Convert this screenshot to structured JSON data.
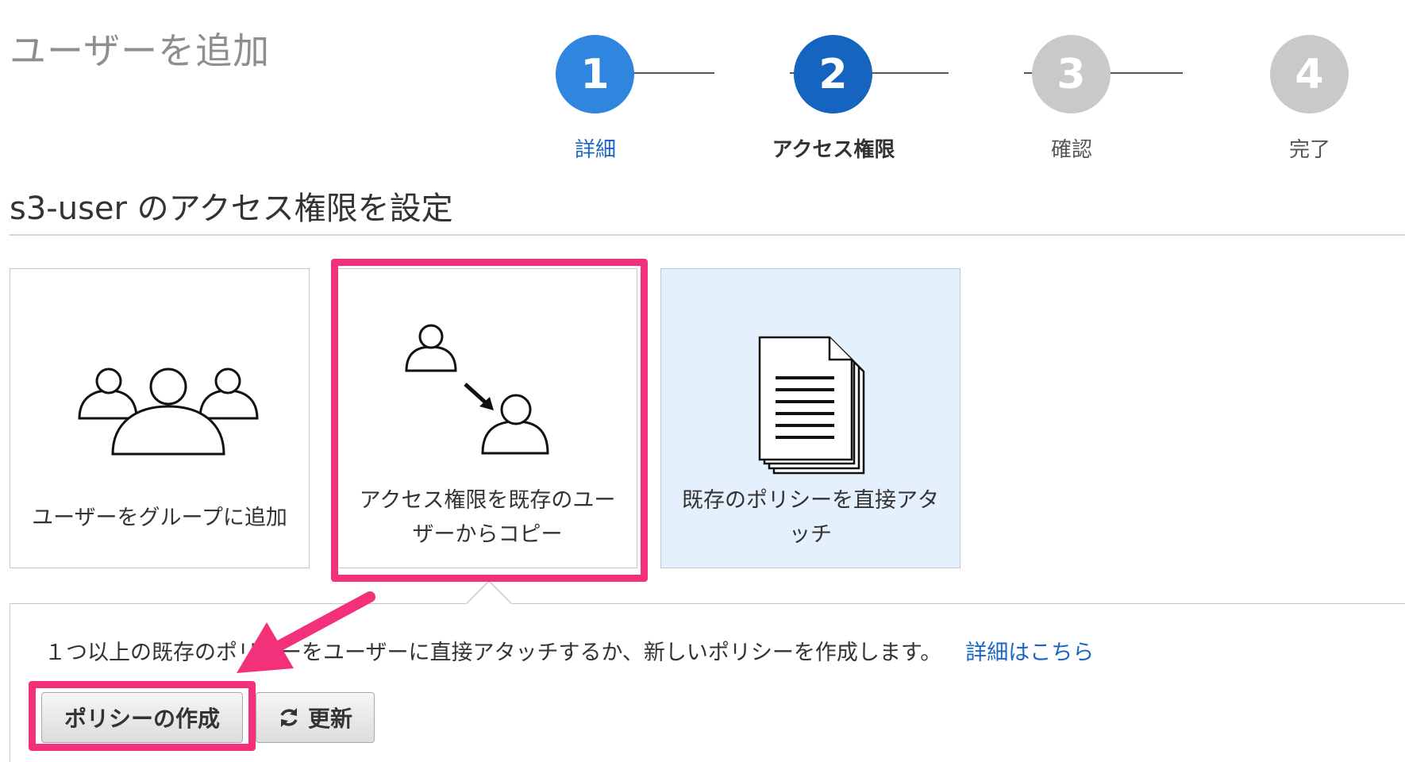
{
  "page_title": "ユーザーを追加",
  "stepper": {
    "steps": [
      {
        "number": "1",
        "label": "詳細",
        "state": "completed",
        "color": "#2e86de",
        "label_color": "#1a66c2"
      },
      {
        "number": "2",
        "label": "アクセス権限",
        "state": "current",
        "color": "#1565c0",
        "label_color": "#333333"
      },
      {
        "number": "3",
        "label": "確認",
        "state": "pending",
        "color": "#c9c9c9",
        "label_color": "#555555"
      },
      {
        "number": "4",
        "label": "完了",
        "state": "pending",
        "color": "#c9c9c9",
        "label_color": "#555555"
      }
    ]
  },
  "section_title": "s3-user のアクセス権限を設定",
  "options": [
    {
      "label": "ユーザーをグループに追加",
      "icon": "group-users-icon"
    },
    {
      "label_line1": "アクセス権限を既存のユー",
      "label_line2": "ザーからコピー",
      "icon": "copy-user-permissions-icon"
    },
    {
      "label_line1": "既存のポリシーを直接アタ",
      "label_line2": "ッチ",
      "icon": "policy-document-icon"
    }
  ],
  "panel": {
    "description": "１つ以上の既存のポリシーをユーザーに直接アタッチするか、新しいポリシーを作成します。",
    "learn_more": "詳細はこちら"
  },
  "buttons": {
    "create_policy": "ポリシーの作成",
    "refresh": "更新"
  },
  "colors": {
    "highlight": "#f2317a",
    "link": "#1a66c2",
    "selected_card_bg": "#e4f0fc"
  }
}
